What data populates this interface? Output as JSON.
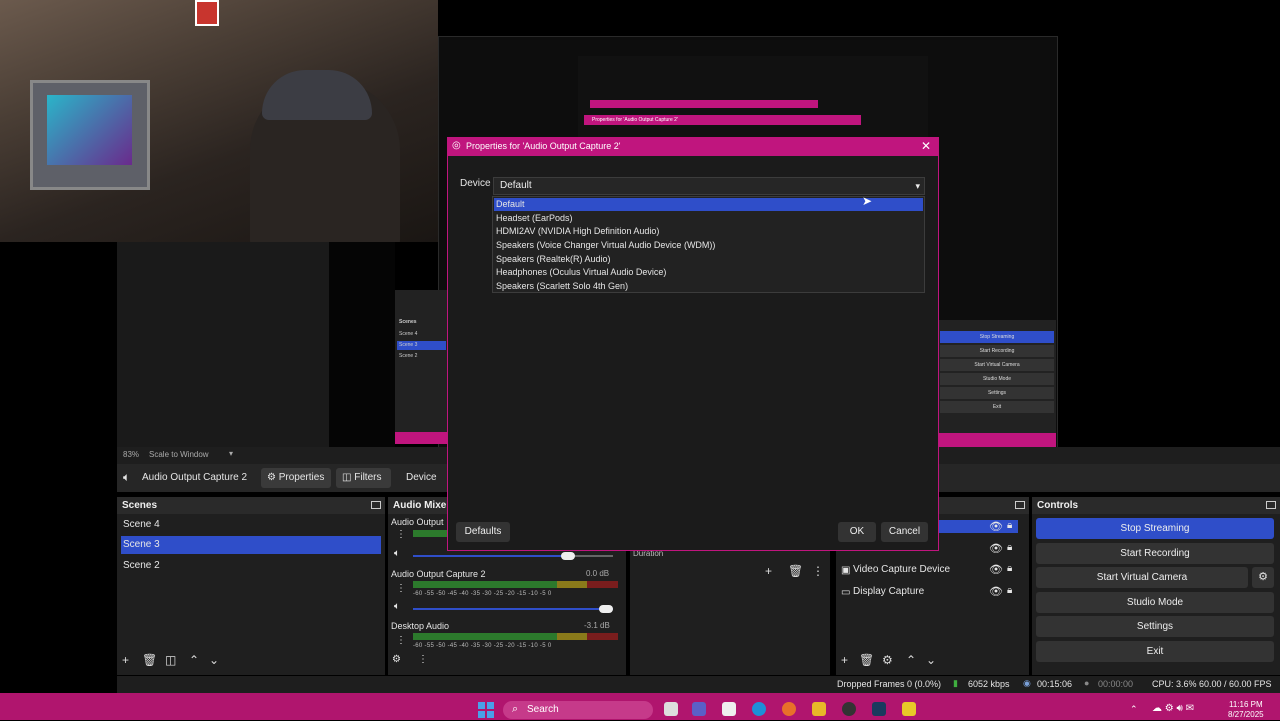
{
  "preview": {
    "zoom_label": "83%",
    "scale_label": "Scale to Window",
    "mini_controls": [
      "Stop Streaming",
      "Start Recording",
      "Start Virtual Camera",
      "Studio Mode",
      "Settings",
      "Exit"
    ],
    "mini_scenes_header": "Scenes",
    "mini_scenes": [
      "Scene 4",
      "Scene 3",
      "Scene 2"
    ],
    "nested_title": "Properties for 'Audio Output Capture 2'"
  },
  "sourcebar": {
    "source_name": "Audio Output Capture 2",
    "properties_label": "Properties",
    "filters_label": "Filters",
    "device_label": "Device"
  },
  "scenes": {
    "title": "Scenes",
    "items": [
      "Scene 4",
      "Scene 3",
      "Scene 2"
    ],
    "selected": "Scene 3"
  },
  "mixer": {
    "title": "Audio Mixer",
    "channels": [
      {
        "name": "Audio Output",
        "db": ""
      },
      {
        "name": "Audio Output Capture 2",
        "db": "0.0 dB"
      },
      {
        "name": "Desktop Audio",
        "db": "-3.1 dB"
      }
    ],
    "ticks": "-60 -55 -50 -45 -40 -35 -30 -25 -20 -15 -10 -5 0"
  },
  "transitions": {
    "duration_label": "Duration"
  },
  "sources": {
    "items": [
      "Video Capture Device",
      "Display Capture"
    ]
  },
  "controls": {
    "title": "Controls",
    "stop_streaming": "Stop Streaming",
    "start_recording": "Start Recording",
    "start_virtual_camera": "Start Virtual Camera",
    "studio_mode": "Studio Mode",
    "settings": "Settings",
    "exit": "Exit"
  },
  "status": {
    "dropped_frames": "Dropped Frames 0 (0.0%)",
    "bitrate": "6052 kbps",
    "stream_time": "00:15:06",
    "rec_time": "00:00:00",
    "cpu": "CPU: 3.6%",
    "fps": "60.00 / 60.00 FPS"
  },
  "dialog": {
    "title": "Properties for 'Audio Output Capture 2'",
    "device_label": "Device",
    "device_value": "Default",
    "options": [
      "Default",
      "Headset (EarPods)",
      "HDMI2AV (NVIDIA High Definition Audio)",
      "Speakers (Voice Changer Virtual Audio Device (WDM))",
      "Speakers (Realtek(R) Audio)",
      "Headphones (Oculus Virtual Audio Device)",
      "Speakers (Scarlett Solo 4th Gen)"
    ],
    "defaults_label": "Defaults",
    "ok_label": "OK",
    "cancel_label": "Cancel"
  },
  "taskbar": {
    "search_label": "Search",
    "time": "11:16 PM",
    "date": "8/27/2025"
  },
  "colors": {
    "accent": "#2f4ec9",
    "dialog_border": "#c0157e",
    "taskbar": "#b0156e"
  }
}
